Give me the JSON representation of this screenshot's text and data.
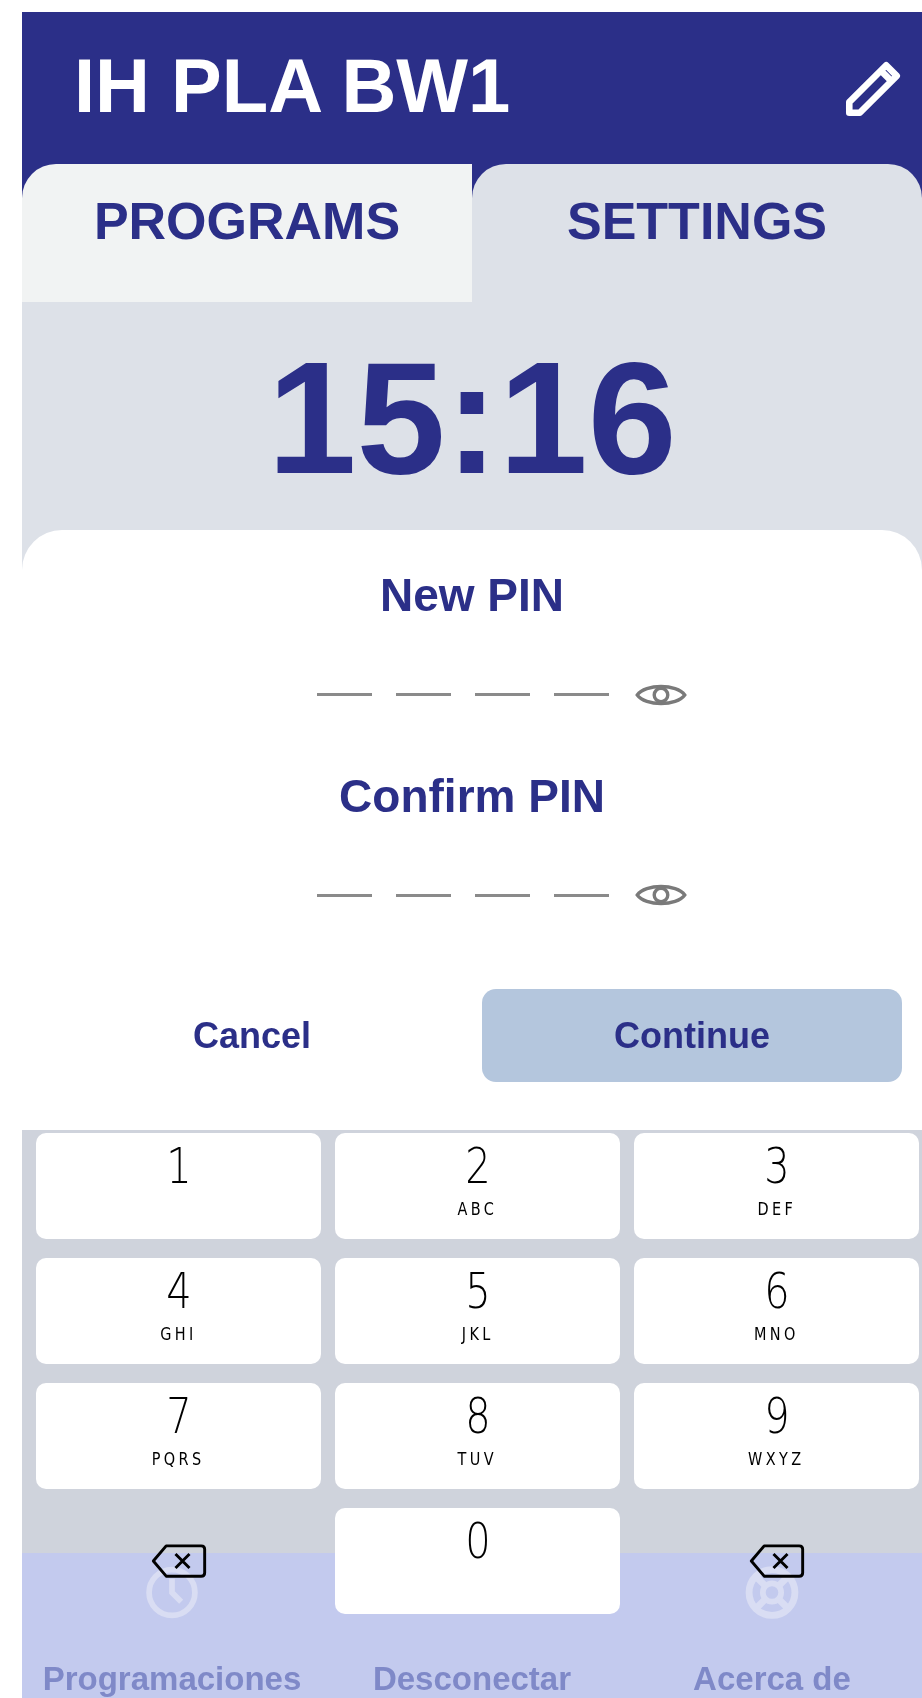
{
  "header": {
    "title": "IH PLA BW1"
  },
  "tabs": [
    {
      "label": "PROGRAMS",
      "selected": false
    },
    {
      "label": "SETTINGS",
      "selected": true
    }
  ],
  "clock": "15:16",
  "pin_dialog": {
    "fields": [
      {
        "label": "New PIN",
        "slots": [
          {
            "filled": false
          },
          {
            "filled": false
          },
          {
            "filled": false
          },
          {
            "filled": false
          }
        ]
      },
      {
        "label": "Confirm PIN",
        "slots": [
          {
            "filled": false
          },
          {
            "filled": false
          },
          {
            "filled": false
          },
          {
            "filled": false
          }
        ]
      }
    ],
    "buttons": [
      {
        "label": "Cancel",
        "kind": "text"
      },
      {
        "label": "Continue",
        "kind": "filled"
      }
    ]
  },
  "keypad": {
    "keys": [
      {
        "kind": "digit",
        "digit": "1"
      },
      {
        "kind": "digit",
        "digit": "2",
        "letters": "ABC"
      },
      {
        "kind": "digit",
        "digit": "3",
        "letters": "DEF"
      },
      {
        "kind": "digit",
        "digit": "4",
        "letters": "GHI"
      },
      {
        "kind": "digit",
        "digit": "5",
        "letters": "JKL"
      },
      {
        "kind": "digit",
        "digit": "6",
        "letters": "MNO"
      },
      {
        "kind": "digit",
        "digit": "7",
        "letters": "PQRS"
      },
      {
        "kind": "digit",
        "digit": "8",
        "letters": "TUV"
      },
      {
        "kind": "digit",
        "digit": "9",
        "letters": "WXYZ"
      },
      {
        "kind": "backspace"
      },
      {
        "kind": "digit",
        "digit": "0"
      },
      {
        "kind": "backspace"
      }
    ]
  },
  "bottom_nav": {
    "items": [
      {
        "label": "Programaciones"
      },
      {
        "label": "Desconectar"
      },
      {
        "label": "Acerca de"
      }
    ]
  }
}
